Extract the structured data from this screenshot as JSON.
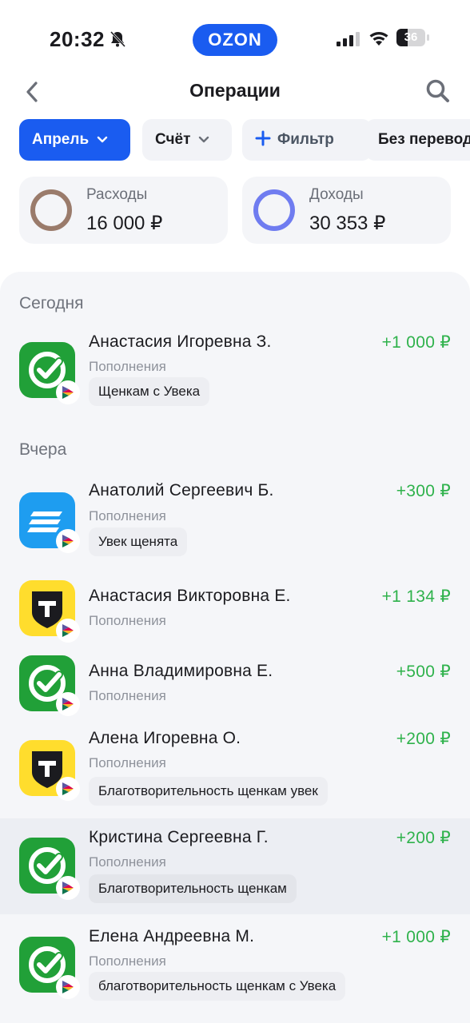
{
  "status_bar": {
    "time": "20:32",
    "battery": "36",
    "icons": [
      "bell-muted-icon",
      "signal-icon",
      "wifi-icon",
      "battery-icon"
    ]
  },
  "brand": {
    "label": "OZON",
    "color": "#1a5cf0"
  },
  "header": {
    "title": "Операции",
    "icons": [
      "chevron-left-icon",
      "search-icon"
    ]
  },
  "filters": {
    "month": "Апрель",
    "account": "Счёт",
    "filter": "Фильтр",
    "no_transfers": "Без перевод"
  },
  "summary": {
    "expenses": {
      "label": "Расходы",
      "value": "16 000 ₽",
      "ring_color": "#9a7b6b"
    },
    "income": {
      "label": "Доходы",
      "value": "30 353 ₽",
      "ring_color": "#6f7cf0"
    }
  },
  "sections": {
    "today": "Сегодня",
    "yesterday": "Вчера"
  },
  "colors": {
    "accent": "#1a5cf0",
    "positive_amount": "#2fb24c",
    "sber_green": "#21a038",
    "tbank_yellow": "#ffdd2d",
    "blue_bank": "#1e9df0"
  },
  "operations": [
    {
      "name": "Анастасия Игоревна З.",
      "amount": "+1 000 ₽",
      "category": "Пополнения",
      "tag": "Щенкам с Увека",
      "bank_icon": "sber-icon"
    },
    {
      "name": "Анатолий Сергеевич Б.",
      "amount": "+300 ₽",
      "category": "Пополнения",
      "tag": "Увек щенята",
      "bank_icon": "blue-bank-icon"
    },
    {
      "name": "Анастасия Викторовна Е.",
      "amount": "+1 134 ₽",
      "category": "Пополнения",
      "tag": "",
      "bank_icon": "tbank-icon"
    },
    {
      "name": "Анна Владимировна Е.",
      "amount": "+500 ₽",
      "category": "Пополнения",
      "tag": "",
      "bank_icon": "sber-icon"
    },
    {
      "name": "Алена Игоревна О.",
      "amount": "+200 ₽",
      "category": "Пополнения",
      "tag": "Благотворительность щенкам увек",
      "bank_icon": "tbank-icon"
    },
    {
      "name": "Кристина Сергеевна Г.",
      "amount": "+200 ₽",
      "category": "Пополнения",
      "tag": "Благотворительность щенкам",
      "bank_icon": "sber-icon"
    },
    {
      "name": "Елена Андреевна М.",
      "amount": "+1 000 ₽",
      "category": "Пополнения",
      "tag": "благотворительность щенкам с Увека",
      "bank_icon": "sber-icon"
    }
  ]
}
